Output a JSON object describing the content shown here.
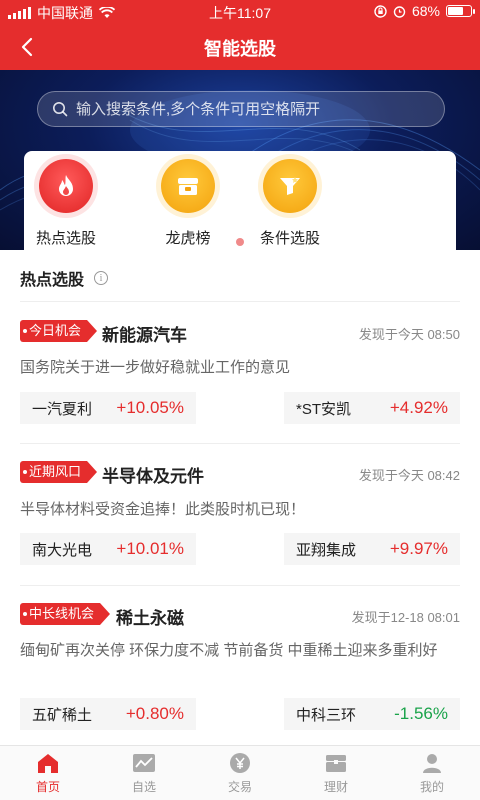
{
  "status": {
    "carrier": "中国联通",
    "time": "上午11:07",
    "battery": "68%",
    "battery_level": 0.68
  },
  "nav": {
    "title": "智能选股"
  },
  "search": {
    "placeholder": "输入搜索条件,多个条件可用空格隔开"
  },
  "quick": [
    {
      "label": "热点选股",
      "icon": "flame-icon"
    },
    {
      "label": "龙虎榜",
      "icon": "treasure-icon"
    },
    {
      "label": "条件选股",
      "icon": "funnel-icon"
    }
  ],
  "section": {
    "title": "热点选股"
  },
  "cards": [
    {
      "tag": "今日机会",
      "topic": "新能源汽车",
      "found": "发现于今天 08:50",
      "desc": "国务院关于进一步做好稳就业工作的意见",
      "stocks": [
        {
          "name": "一汽夏利",
          "change": "+10.05%",
          "dir": "up"
        },
        {
          "name": "*ST安凯",
          "change": "+4.92%",
          "dir": "up"
        }
      ]
    },
    {
      "tag": "近期风口",
      "topic": "半导体及元件",
      "found": "发现于今天 08:42",
      "desc": "半导体材料受资金追捧！此类股时机已现！",
      "stocks": [
        {
          "name": "南大光电",
          "change": "+10.01%",
          "dir": "up"
        },
        {
          "name": "亚翔集成",
          "change": "+9.97%",
          "dir": "up"
        }
      ]
    },
    {
      "tag": "中长线机会",
      "topic": "稀土永磁",
      "found": "发现于12-18 08:01",
      "desc": "缅甸矿再次关停 环保力度不减 节前备货 中重稀土迎来多重利好",
      "stocks": [
        {
          "name": "五矿稀土",
          "change": "+0.80%",
          "dir": "up"
        },
        {
          "name": "中科三环",
          "change": "-1.56%",
          "dir": "down"
        }
      ]
    }
  ],
  "tabs": [
    {
      "label": "首页",
      "icon": "home-icon",
      "active": true
    },
    {
      "label": "自选",
      "icon": "chart-icon",
      "active": false
    },
    {
      "label": "交易",
      "icon": "yen-icon",
      "active": false
    },
    {
      "label": "理财",
      "icon": "wallet-icon",
      "active": false
    },
    {
      "label": "我的",
      "icon": "user-icon",
      "active": false
    }
  ],
  "colors": {
    "primary": "#e52d2d",
    "up": "#e52d2d",
    "down": "#1aa34a",
    "banner": "#0c1d5a"
  }
}
